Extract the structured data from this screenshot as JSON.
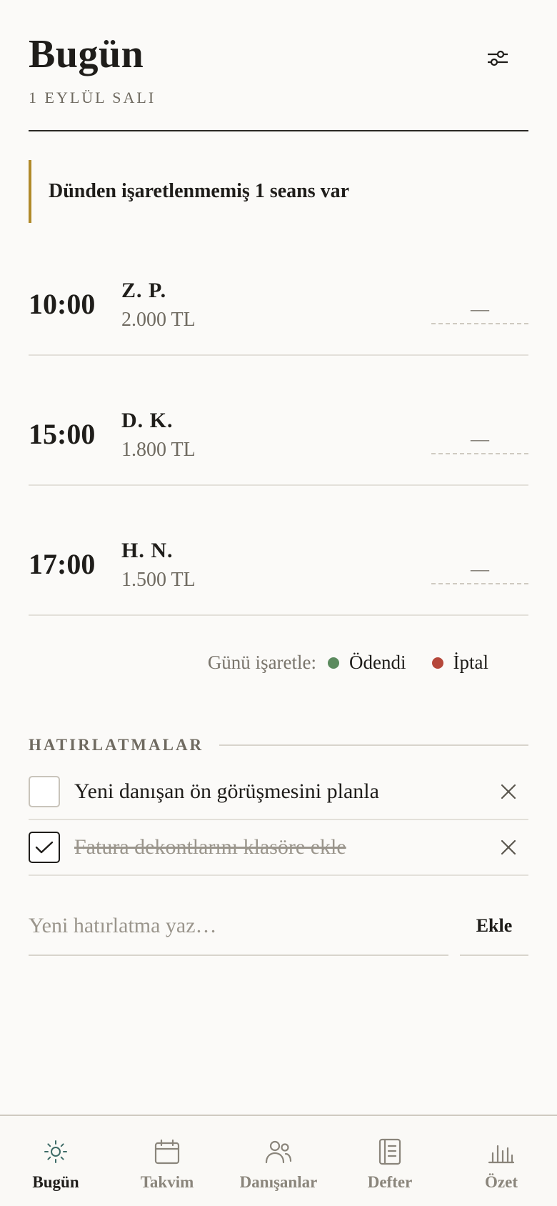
{
  "header": {
    "title": "Bugün",
    "date": "1 EYLÜL SALI",
    "filter_icon": "sliders-icon"
  },
  "alert": {
    "text": "Dünden işaretlenmemiş 1 seans var"
  },
  "sessions": [
    {
      "time": "10:00",
      "client": "Z. P.",
      "fee": "2.000 TL",
      "status": "—"
    },
    {
      "time": "15:00",
      "client": "D. K.",
      "fee": "1.800 TL",
      "status": "—"
    },
    {
      "time": "17:00",
      "client": "H. N.",
      "fee": "1.500 TL",
      "status": "—"
    }
  ],
  "legend": {
    "label": "Günü işaretle:",
    "paid": "Ödendi",
    "cancel": "İptal",
    "paid_color": "#5b8a5e",
    "cancel_color": "#b5473a"
  },
  "reminders": {
    "title": "HATIRLATMALAR",
    "items": [
      {
        "text": "Yeni danışan ön görüşmesini planla",
        "done": false
      },
      {
        "text": "Fatura dekontlarını klasöre ekle",
        "done": true
      }
    ],
    "input_placeholder": "Yeni hatırlatma yaz…",
    "add_label": "Ekle"
  },
  "tabs": [
    {
      "label": "Bugün",
      "icon": "sun-icon",
      "active": true
    },
    {
      "label": "Takvim",
      "icon": "calendar-icon",
      "active": false
    },
    {
      "label": "Danışanlar",
      "icon": "users-icon",
      "active": false
    },
    {
      "label": "Defter",
      "icon": "notebook-icon",
      "active": false
    },
    {
      "label": "Özet",
      "icon": "bar-chart-icon",
      "active": false
    }
  ],
  "colors": {
    "accent": "#b08a2a",
    "active_tab_icon": "#3d6b66"
  }
}
